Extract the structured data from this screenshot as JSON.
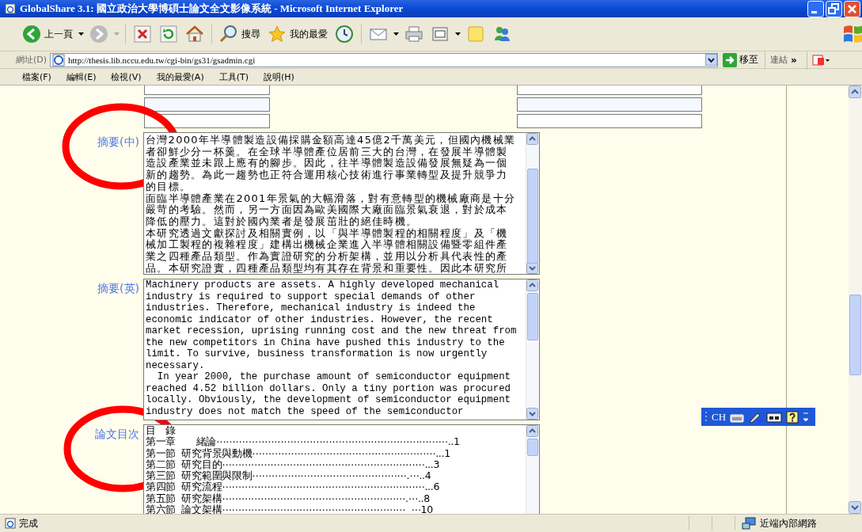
{
  "window": {
    "title": "GlobalShare 3.1: 國立政治大學博碩士論文全文影像系統 - Microsoft Internet Explorer"
  },
  "toolbar": [
    {
      "kind": "back",
      "label": "上一頁"
    },
    {
      "kind": "forward"
    },
    {
      "kind": "stop"
    },
    {
      "kind": "refresh"
    },
    {
      "kind": "home"
    },
    {
      "kind": "search",
      "label": "搜尋"
    },
    {
      "kind": "favorites",
      "label": "我的最愛"
    },
    {
      "kind": "history"
    },
    {
      "kind": "mail"
    },
    {
      "kind": "print"
    },
    {
      "kind": "edit"
    },
    {
      "kind": "note"
    },
    {
      "kind": "messenger"
    }
  ],
  "address_bar": {
    "label": "網址(D)",
    "url": "http://thesis.lib.nccu.edu.tw/cgi-bin/gs31/gsadmin.cgi",
    "go": "移至",
    "links": "連結",
    "more": "»"
  },
  "menu_bar": [
    "檔案(F)",
    "編輯(E)",
    "檢視(V)",
    "我的最愛(A)",
    "工具(T)",
    "說明(H)"
  ],
  "field_rows": [
    {
      "kind": "pair"
    },
    {
      "kind": "pair"
    },
    {
      "kind": "pair"
    }
  ],
  "sections": [
    {
      "label": "摘要(中)",
      "kind": "cjk",
      "lines": [
        "台灣2000年半導體製造設備採購金額高達45億2千萬美元，但國內機械業",
        "者卻鮮少分一杯羹。在全球半導體產位居前三大的台灣，在發展半導體製",
        "造設產業並未跟上應有的腳步。因此，往半導體製造設備發展無疑為一個",
        "新的趨勢。為此一趨勢也正符合運用核心技術進行事業轉型及提升競爭力",
        "的目標。",
        "面臨半導體產業在2001年景氣的大幅滑落，對有意轉型的機械廠商是十分",
        "嚴苛的考驗。然而，另一方面因為歐美國際大廠面臨景氣衰退，對於成本",
        "降低的壓力。這對於國內業者是發展茁壯的絕佳時機。",
        "本研究透過文獻探討及相關實例，以「與半導體製程的相關程度」及「機",
        "械加工製程的複雜程度」建構出機械企業進入半導體相關設備暨零組件產",
        "業之四種產品類型。作為實證研究的分析架構，並用以分析具代表性的產",
        "品。本研究證實，四種產品類型均有其存在背景和重要性。因此本研究所"
      ]
    },
    {
      "label": "摘要(英)",
      "kind": "mono",
      "lines": [
        "Machinery products are assets. A highly developed mechanical",
        "industry is required to support special demands of other",
        "industries. Therefore, mechanical industry is indeed the",
        "economic indicator of other industries. However, the recent",
        "market recession, uprising running cost and the new threat from",
        "the new competitors in China have pushed this industry to the",
        "limit. To survive, business transformation is now urgently",
        "necessary.",
        "  In year 2000, the purchase amount of semiconductor equipment",
        "reached 4.52 billion dollars. Only a tiny portion was procured",
        "locally. Obviously, the development of semiconductor equipment",
        "industry does not match the speed of the semiconductor"
      ]
    },
    {
      "label": "論文目次",
      "kind": "toc",
      "lines": [
        "目　錄",
        "第一章　　緒論⋯⋯⋯⋯⋯⋯⋯⋯⋯⋯⋯⋯⋯⋯⋯⋯⋯⋯⋯⋯⋯⋯⋯⋯..1",
        "第一節  研究背景與動機⋯⋯⋯⋯⋯⋯⋯⋯⋯⋯⋯⋯⋯⋯⋯⋯⋯⋯⋯...1",
        "第二節  研究目的⋯⋯⋯⋯⋯⋯⋯⋯⋯⋯⋯⋯⋯⋯⋯⋯⋯⋯⋯⋯⋯...3",
        "第三節  研究範圍與限制⋯⋯⋯⋯⋯⋯⋯⋯⋯⋯⋯⋯⋯⋯⋯⋯.⋯..4",
        "第四節  研究流程⋯⋯⋯⋯⋯⋯⋯⋯⋯⋯⋯⋯⋯⋯⋯⋯⋯⋯⋯⋯⋯...6",
        "第五節  研究架構⋯⋯⋯⋯⋯⋯⋯⋯⋯⋯⋯⋯⋯⋯⋯⋯⋯⋯⋯.⋯..8",
        "第六節  論文架構⋯⋯⋯⋯⋯⋯⋯⋯⋯⋯⋯⋯⋯⋯⋯⋯⋯⋯⋯  ⋯10"
      ]
    }
  ],
  "language_bar": {
    "label": "CH"
  },
  "annotations": [
    {
      "kind": "circle"
    },
    {
      "kind": "circle"
    }
  ],
  "status_bar": {
    "text": "完成",
    "zone": "近端內部網路"
  }
}
